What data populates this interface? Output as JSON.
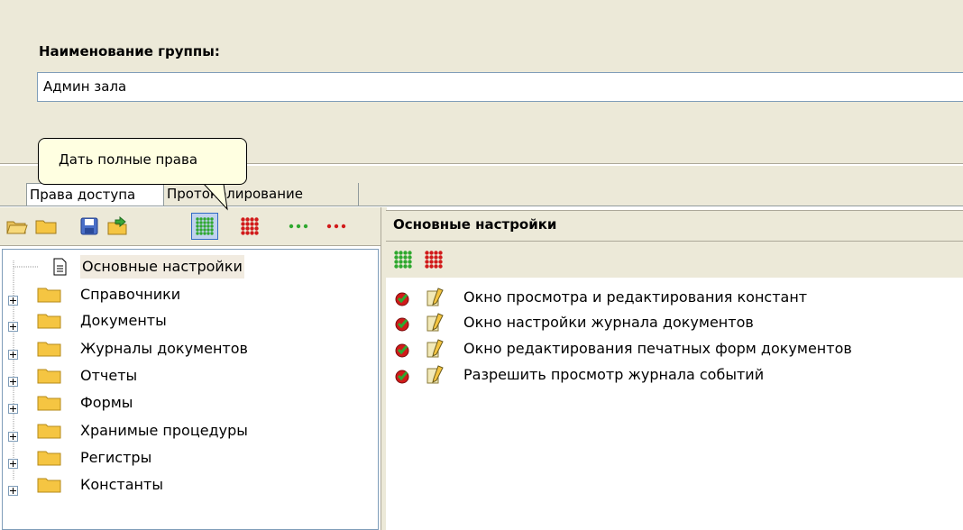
{
  "group": {
    "label": "Наименование группы:",
    "value": "Админ зала"
  },
  "tabs": [
    {
      "label": "Права доступа"
    },
    {
      "label": "Протоколирование"
    }
  ],
  "tooltip": "Дать полные права",
  "left_toolbar": {
    "buttons": [
      {
        "icon": "open-folder-icon"
      },
      {
        "icon": "folder-icon"
      },
      {
        "icon": "save-icon"
      },
      {
        "icon": "load-folder-icon"
      },
      {
        "icon": "grant-full-rights-icon"
      },
      {
        "icon": "revoke-full-rights-icon"
      },
      {
        "icon": "grant-green-dots-icon"
      },
      {
        "icon": "revoke-red-dots-icon"
      }
    ]
  },
  "tree": [
    {
      "label": "Основные настройки",
      "icon": "document-icon",
      "expandable": false,
      "selected": true
    },
    {
      "label": "Справочники",
      "icon": "folder-icon",
      "expandable": true
    },
    {
      "label": "Документы",
      "icon": "folder-icon",
      "expandable": true
    },
    {
      "label": "Журналы документов",
      "icon": "folder-icon",
      "expandable": true
    },
    {
      "label": "Отчеты",
      "icon": "folder-icon",
      "expandable": true
    },
    {
      "label": "Формы",
      "icon": "folder-icon",
      "expandable": true
    },
    {
      "label": "Хранимые процедуры",
      "icon": "folder-icon",
      "expandable": true
    },
    {
      "label": "Регистры",
      "icon": "folder-icon",
      "expandable": true
    },
    {
      "label": "Константы",
      "icon": "folder-icon",
      "expandable": true
    }
  ],
  "right": {
    "title": "Основные настройки",
    "items": [
      {
        "label": "Окно просмотра и редактирования констант",
        "status": "granted"
      },
      {
        "label": "Окно настройки журнала документов",
        "status": "granted"
      },
      {
        "label": "Окно редактирования печатных форм документов",
        "status": "granted"
      },
      {
        "label": "Разрешить просмотр журнала событий",
        "status": "granted"
      }
    ]
  },
  "colors": {
    "green": "#2fa82f",
    "red": "#d11a1a",
    "folder": "#f5c542",
    "panel": "#ece9d8"
  }
}
